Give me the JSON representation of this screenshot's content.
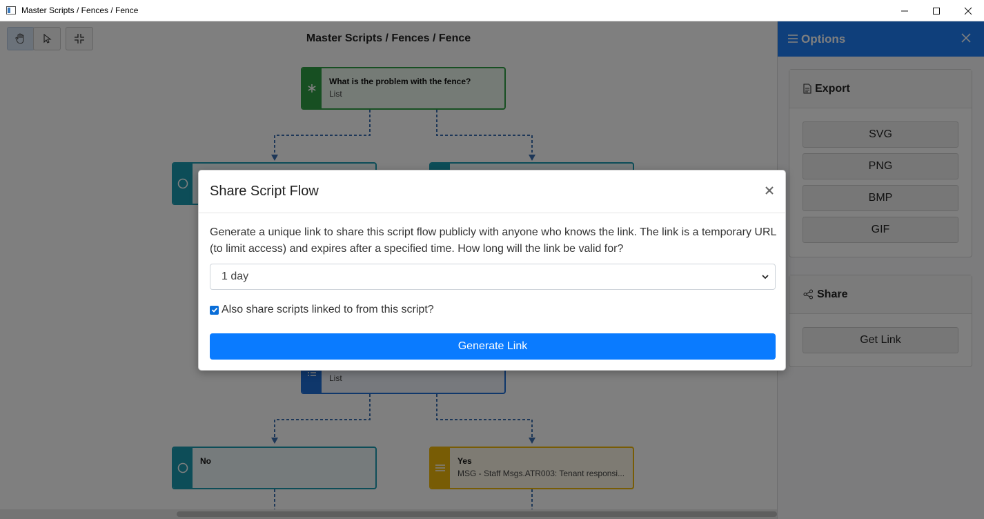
{
  "window": {
    "title": "Master Scripts / Fences / Fence"
  },
  "canvas": {
    "title": "Master Scripts / Fences / Fence",
    "tools": [
      "hand-icon",
      "pointer-icon",
      "collapse-icon"
    ],
    "nodes": {
      "root": {
        "title": "What is the problem with the fence?",
        "subtitle": "List"
      },
      "middle": {
        "title": "",
        "subtitle": "List"
      },
      "no": {
        "title": "No",
        "subtitle": ""
      },
      "yes": {
        "title": "Yes",
        "subtitle": "MSG - Staff Msgs.ATR003: Tenant responsi..."
      }
    }
  },
  "options": {
    "title": "Options",
    "export": {
      "title": "Export",
      "buttons": [
        "SVG",
        "PNG",
        "BMP",
        "GIF"
      ]
    },
    "share": {
      "title": "Share",
      "button": "Get Link"
    }
  },
  "modal": {
    "title": "Share Script Flow",
    "description": "Generate a unique link to share this script flow publicly with anyone who knows the link. The link is a temporary URL (to limit access) and expires after a specified time. How long will the link be valid for?",
    "duration": {
      "selected": "1 day"
    },
    "also_share": {
      "label": "Also share scripts linked to from this script?",
      "checked": true
    },
    "generate_label": "Generate Link"
  },
  "colors": {
    "accent": "#1f7ef6",
    "primary_button": "#0a7bff",
    "node_green": "#2e9e44",
    "node_teal": "#1a9bb0",
    "node_blue": "#1f6fd6",
    "node_yellow": "#f0b90b"
  }
}
